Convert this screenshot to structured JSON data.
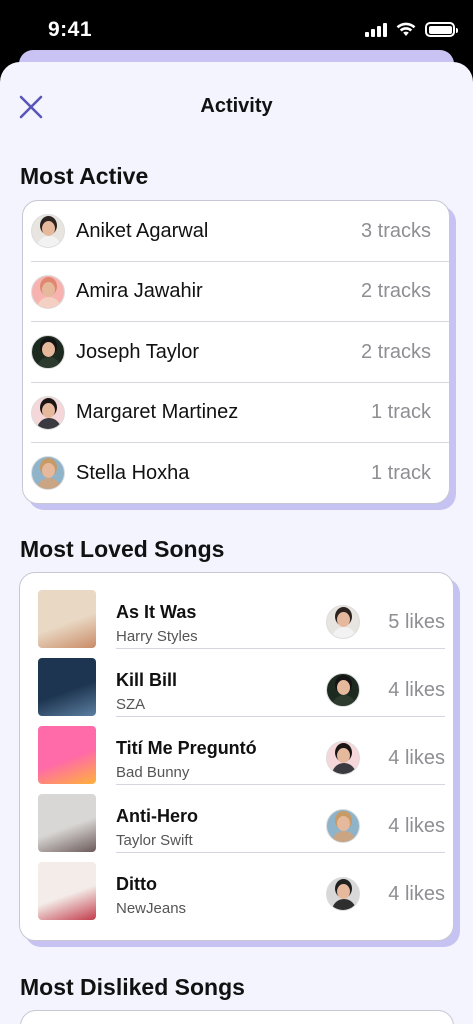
{
  "status": {
    "time": "9:41"
  },
  "sheet": {
    "title": "Activity"
  },
  "most_active": {
    "title": "Most Active",
    "users": [
      {
        "name": "Aniket Agarwal",
        "count": "3 tracks",
        "avatar_bg": "#e8e4e0",
        "hair": "#2b2320",
        "shirt": "#f2f2f2"
      },
      {
        "name": "Amira Jawahir",
        "count": "2 tracks",
        "avatar_bg": "#f7b3b0",
        "hair": "#e08770",
        "shirt": "#f4d0c2"
      },
      {
        "name": "Joseph Taylor",
        "count": "2 tracks",
        "avatar_bg": "#1c2a20",
        "hair": "#141414",
        "shirt": "#2d3b2e"
      },
      {
        "name": "Margaret Martinez",
        "count": "1 track",
        "avatar_bg": "#f5d7d9",
        "hair": "#1a1616",
        "shirt": "#3a3a40"
      },
      {
        "name": "Stella Hoxha",
        "count": "1 track",
        "avatar_bg": "#8fb3c9",
        "hair": "#c79a66",
        "shirt": "#caa583"
      }
    ]
  },
  "most_loved": {
    "title": "Most Loved Songs",
    "songs": [
      {
        "title": "As It Was",
        "artist": "Harry Styles",
        "likes": "5 likes",
        "cover_colors": [
          "#e9d8c4",
          "#c98b66"
        ],
        "avatar_bg": "#e8e4e0",
        "hair": "#2b2320",
        "shirt": "#f2f2f2"
      },
      {
        "title": "Kill Bill",
        "artist": "SZA",
        "likes": "4 likes",
        "cover_colors": [
          "#1d3550",
          "#5d7fa1"
        ],
        "avatar_bg": "#1c2a20",
        "hair": "#141414",
        "shirt": "#2d3b2e"
      },
      {
        "title": "Tití Me Preguntó",
        "artist": "Bad Bunny",
        "likes": "4 likes",
        "cover_colors": [
          "#ff6aa8",
          "#ffb23c"
        ],
        "avatar_bg": "#f5d7d9",
        "hair": "#1a1616",
        "shirt": "#3a3a40"
      },
      {
        "title": "Anti-Hero",
        "artist": "Taylor Swift",
        "likes": "4 likes",
        "cover_colors": [
          "#d9d7d5",
          "#6b5a59"
        ],
        "avatar_bg": "#8fb3c9",
        "hair": "#c79a66",
        "shirt": "#caa583"
      },
      {
        "title": "Ditto",
        "artist": "NewJeans",
        "likes": "4 likes",
        "cover_colors": [
          "#f3ece8",
          "#c23b4b"
        ],
        "avatar_bg": "#d8d8d8",
        "hair": "#202020",
        "shirt": "#2e2e2e"
      }
    ]
  },
  "most_disliked": {
    "title": "Most Disliked Songs"
  },
  "colors": {
    "accent": "#5b55b8",
    "shadow": "#c6c2f2",
    "sheet_bg": "#f4f4fe"
  }
}
